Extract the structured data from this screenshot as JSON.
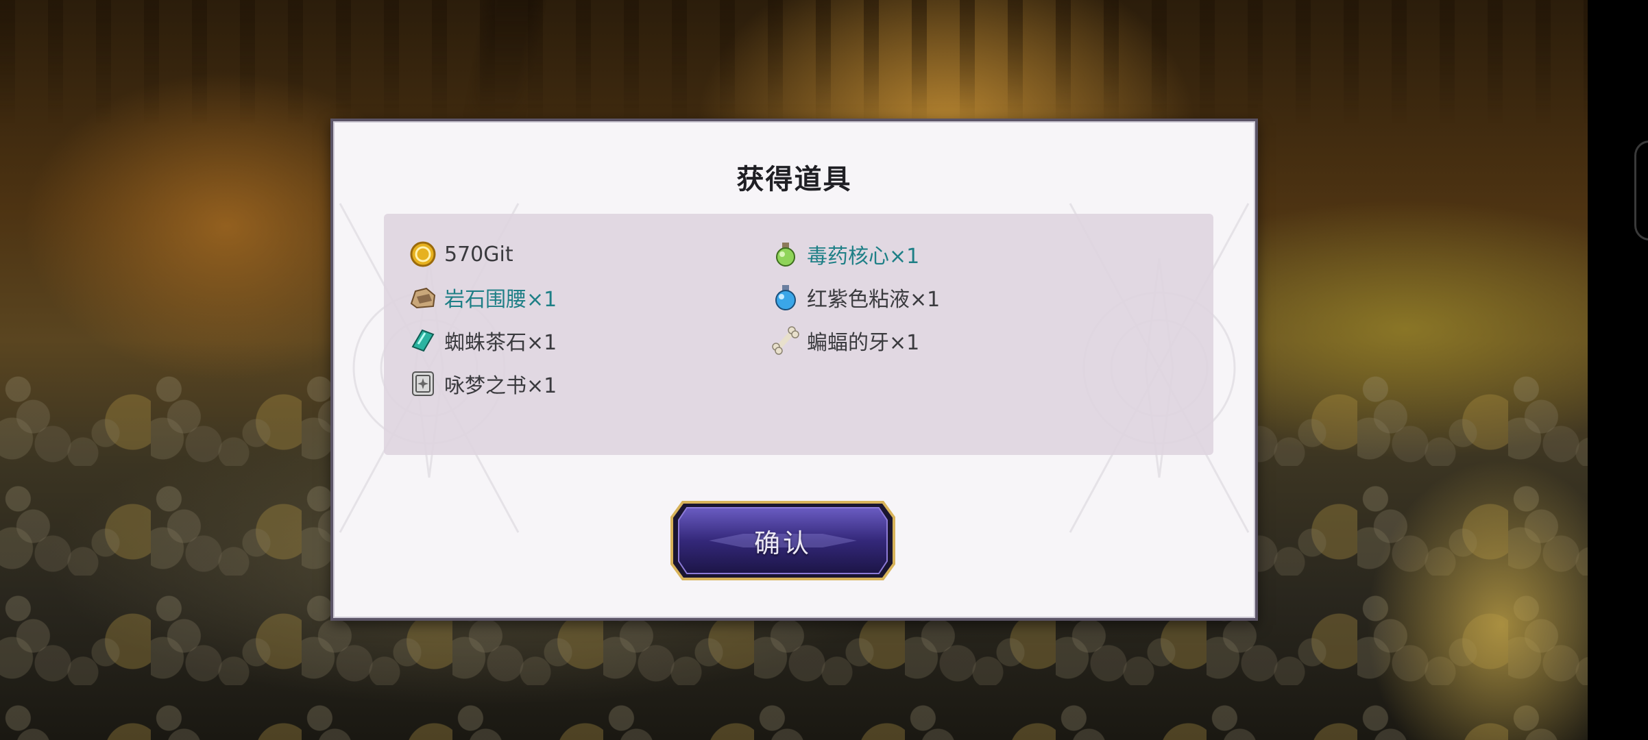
{
  "dialog": {
    "title": "获得道具",
    "confirm_label": "确认"
  },
  "items": [
    {
      "label": "570Git",
      "icon": "gold-coin-icon",
      "rarity": "normal"
    },
    {
      "label": "毒药核心×1",
      "icon": "green-potion-icon",
      "rarity": "rare"
    },
    {
      "label": "岩石围腰×1",
      "icon": "rock-belt-icon",
      "rarity": "rare"
    },
    {
      "label": "红紫色粘液×1",
      "icon": "blue-potion-icon",
      "rarity": "normal"
    },
    {
      "label": "蜘蛛茶石×1",
      "icon": "teal-gem-icon",
      "rarity": "normal"
    },
    {
      "label": "蝙蝠的牙×1",
      "icon": "bone-icon",
      "rarity": "normal"
    },
    {
      "label": "咏梦之书×1",
      "icon": "book-icon",
      "rarity": "normal"
    }
  ],
  "colors": {
    "rare_text": "#1e7f86",
    "normal_text": "#3a3a3e",
    "dialog_bg": "#f7f5f8",
    "panel_bg": "#ded5e0",
    "button_fill": "#3b2f7a",
    "button_border": "#c9a24a"
  }
}
